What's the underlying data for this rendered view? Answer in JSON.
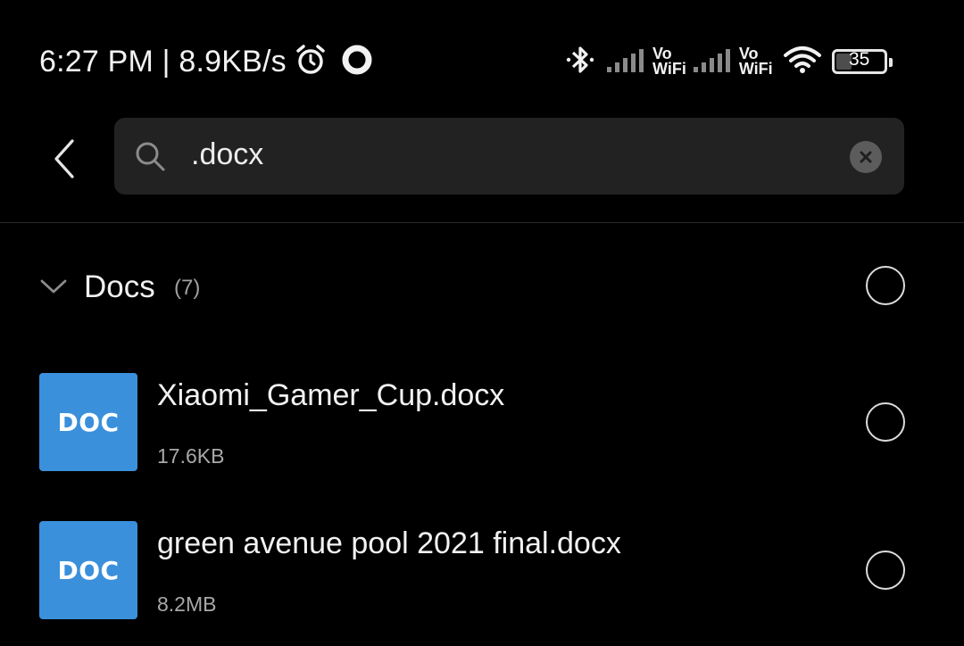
{
  "status_bar": {
    "time_speed": "6:27 PM | 8.9KB/s",
    "icons": [
      "alarm-icon",
      "circle-notification-icon",
      "bluetooth-icon",
      "signal-icon",
      "vowifi-icon",
      "signal-icon",
      "vowifi-icon",
      "wifi-icon",
      "battery-icon"
    ],
    "vowifi_top": "Vo",
    "vowifi_bottom": "WiFi",
    "battery": "35"
  },
  "search": {
    "value": ".docx",
    "back_icon": "chevron-left-icon",
    "search_icon": "search-icon",
    "clear_icon": "clear-icon"
  },
  "group": {
    "title": "Docs",
    "count": "(7)"
  },
  "files": [
    {
      "icon_label": "DOC",
      "name": "Xiaomi_Gamer_Cup.docx",
      "size": "17.6KB"
    },
    {
      "icon_label": "DOC",
      "name": "green avenue pool 2021 final.docx",
      "size": "8.2MB"
    }
  ],
  "colors": {
    "background": "#000000",
    "search_box": "#222222",
    "doc_icon": "#3a90db",
    "secondary_text": "#a8a8a8"
  }
}
